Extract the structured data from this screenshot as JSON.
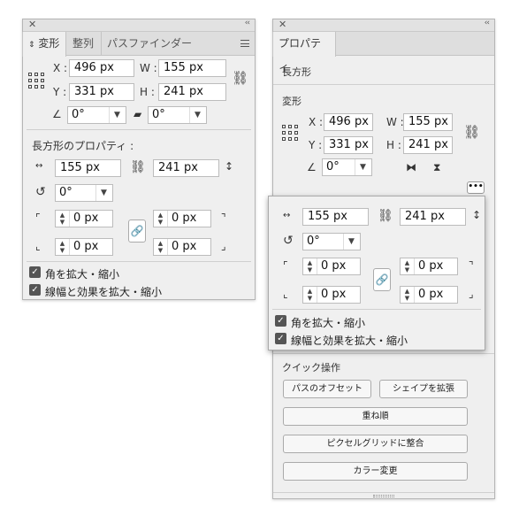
{
  "transform_panel": {
    "tabs": [
      "変形",
      "整列",
      "パスファインダー"
    ],
    "x_label": "X :",
    "x_value": "496 px",
    "y_label": "Y :",
    "y_value": "331 px",
    "w_label": "W :",
    "w_value": "155 px",
    "h_label": "H :",
    "h_value": "241 px",
    "rotate_value": "0°",
    "shear_value": "0°",
    "rect_props_title": "長方形のプロパティ :",
    "rect_w": "155 px",
    "rect_h": "241 px",
    "rect_rotate": "0°",
    "corner_tl": "0 px",
    "corner_tr": "0 px",
    "corner_bl": "0 px",
    "corner_br": "0 px",
    "scale_corners_label": "角を拡大・縮小",
    "scale_strokes_label": "線幅と効果を拡大・縮小"
  },
  "properties_panel": {
    "tab": "プロパティ",
    "object_type": "長方形",
    "transform_title": "変形",
    "x_label": "X :",
    "x_value": "496 px",
    "y_label": "Y :",
    "y_value": "331 px",
    "w_label": "W :",
    "w_value": "155 px",
    "h_label": "H :",
    "h_value": "241 px",
    "rotate_value": "0°",
    "popup": {
      "w_value": "155 px",
      "h_value": "241 px",
      "rotate_value": "0°",
      "corner_tl": "0 px",
      "corner_tr": "0 px",
      "corner_bl": "0 px",
      "corner_br": "0 px",
      "scale_corners_label": "角を拡大・縮小",
      "scale_strokes_label": "線幅と効果を拡大・縮小"
    },
    "quick_actions_title": "クイック操作",
    "offset_path_button": "パスのオフセット",
    "expand_shape_button": "シェイプを拡張",
    "arrange_button": "重ね順",
    "pixel_grid_button": "ピクセルグリッドに整合",
    "recolor_button": "カラー変更"
  }
}
